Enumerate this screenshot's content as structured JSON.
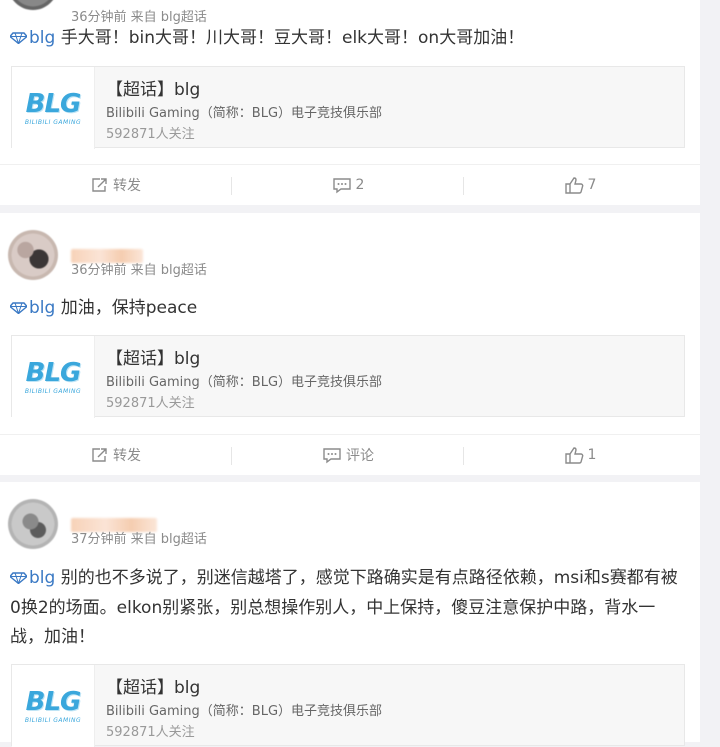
{
  "colors": {
    "tag": "#3a79c4",
    "muted": "#8b8b8b",
    "logo": "#3aa7dc"
  },
  "topic": {
    "logo_text": "BLG",
    "logo_sub": "BILIBILI GAMING",
    "title": "【超话】blg",
    "desc": "Bilibili Gaming（简称：BLG）电子竞技俱乐部",
    "followers": "592871人关注"
  },
  "posts": [
    {
      "meta": "36分钟前 来自 blg超话",
      "tag": "blg",
      "text": " 手大哥！bin大哥！川大哥！豆大哥！elk大哥！on大哥加油！",
      "actions": {
        "repost": "转发",
        "comment": "2",
        "like": "7"
      }
    },
    {
      "meta": "36分钟前 来自 blg超话",
      "tag": "blg",
      "text": " 加油，保持peace",
      "actions": {
        "repost": "转发",
        "comment": "评论",
        "like": "1"
      }
    },
    {
      "meta": "37分钟前 来自 blg超话",
      "tag": "blg",
      "text": " 别的也不多说了，别迷信越塔了，感觉下路确实是有点路径依赖，msi和s赛都有被0换2的场面。elkon别紧张，别总想操作别人，中上保持，傻豆注意保护中路，背水一战，加油！"
    }
  ]
}
